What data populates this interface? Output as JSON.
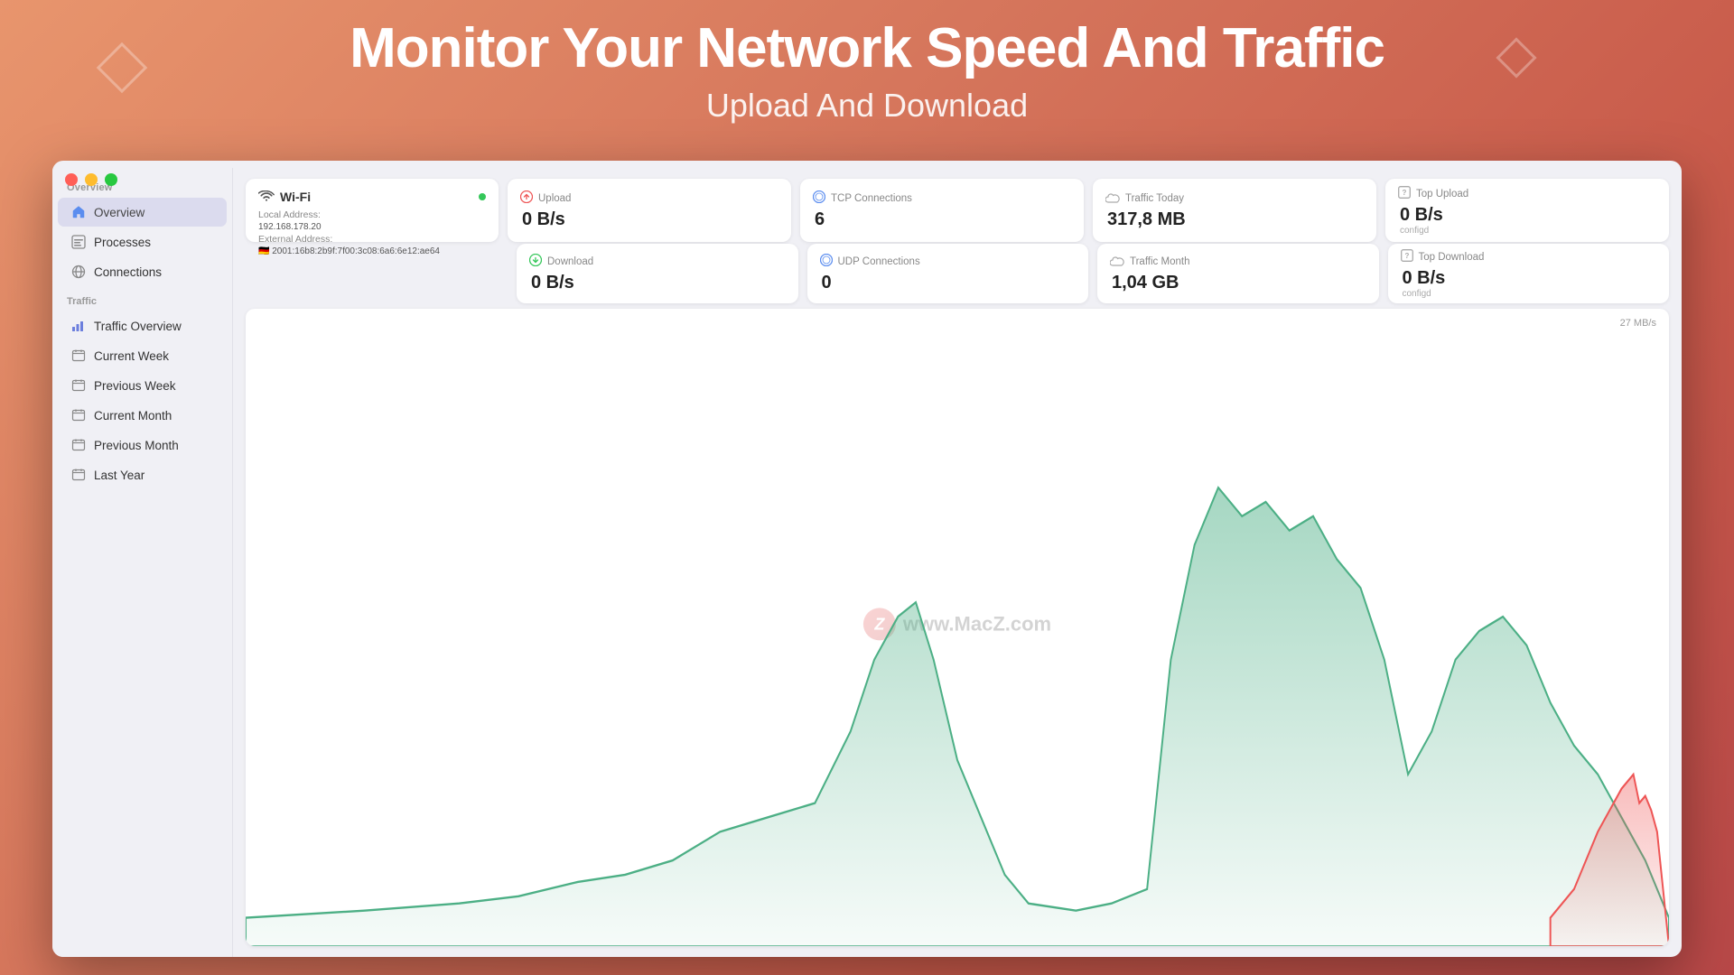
{
  "page": {
    "title": "Monitor Your Network Speed And Traffic",
    "subtitle": "Upload And Download"
  },
  "sidebar": {
    "section_overview": "Overview",
    "section_traffic": "Traffic",
    "items_overview": [
      {
        "id": "overview",
        "label": "Overview",
        "icon": "🏠",
        "active": true
      },
      {
        "id": "processes",
        "label": "Processes",
        "icon": "📊"
      },
      {
        "id": "connections",
        "label": "Connections",
        "icon": "🌐"
      }
    ],
    "items_traffic": [
      {
        "id": "traffic-overview",
        "label": "Traffic Overview",
        "icon": "📊"
      },
      {
        "id": "current-week",
        "label": "Current Week",
        "icon": "📅"
      },
      {
        "id": "previous-week",
        "label": "Previous Week",
        "icon": "📅"
      },
      {
        "id": "current-month",
        "label": "Current Month",
        "icon": "📅"
      },
      {
        "id": "previous-month",
        "label": "Previous Month",
        "icon": "📅"
      },
      {
        "id": "last-year",
        "label": "Last Year",
        "icon": "📅"
      }
    ]
  },
  "wifi": {
    "name": "Wi-Fi",
    "status": "connected",
    "local_label": "Local Address:",
    "local_value": "192.168.178.20",
    "external_label": "External Address:",
    "flag": "🇩🇪",
    "external_value": "2001:16b8:2b9f:7f00:3c08:6a6:6e12:ae64"
  },
  "stats": {
    "upload": {
      "label": "Upload",
      "value": "0 B/s",
      "icon": "upload"
    },
    "download": {
      "label": "Download",
      "value": "0 B/s",
      "icon": "download"
    },
    "tcp": {
      "label": "TCP Connections",
      "value": "6",
      "icon": "network"
    },
    "udp": {
      "label": "UDP Connections",
      "value": "0",
      "icon": "network"
    },
    "traffic_today": {
      "label": "Traffic Today",
      "value": "317,8 MB",
      "icon": "cloud"
    },
    "traffic_month": {
      "label": "Traffic Month",
      "value": "1,04 GB",
      "icon": "cloud"
    },
    "top_upload": {
      "label": "Top Upload",
      "value": "0 B/s",
      "sub": "configd",
      "icon": "question"
    },
    "top_download": {
      "label": "Top Download",
      "value": "0 B/s",
      "sub": "configd",
      "icon": "question"
    }
  },
  "chart": {
    "max_label": "27 MB/s",
    "watermark_text": "www.MacZ.com"
  },
  "window": {
    "controls": {
      "close": "close",
      "minimize": "minimize",
      "maximize": "maximize"
    }
  }
}
